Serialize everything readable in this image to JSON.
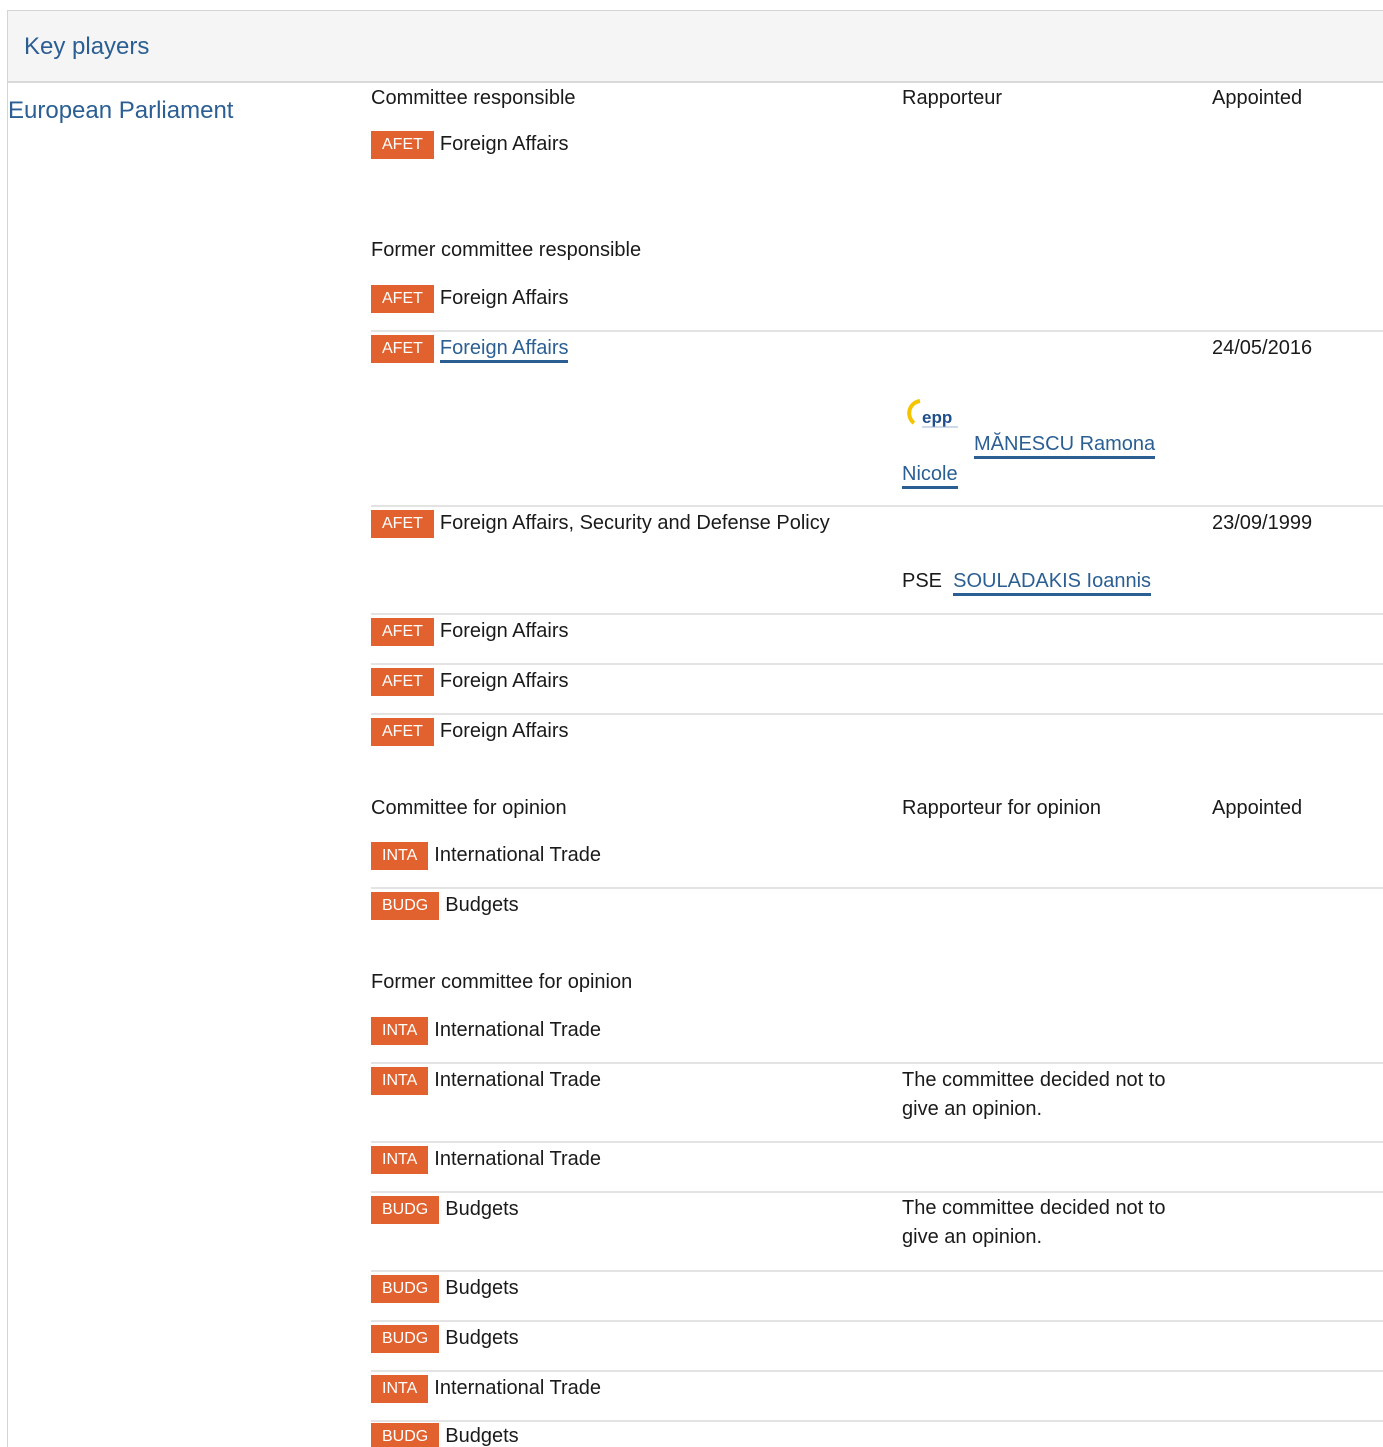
{
  "panel": {
    "title": "Key players"
  },
  "institution": {
    "label": "European Parliament"
  },
  "responsible": {
    "col_committee": "Committee responsible",
    "col_rapporteur": "Rapporteur",
    "col_appointed": "Appointed",
    "current": {
      "code": "AFET",
      "name": "Foreign Affairs"
    },
    "former_heading": "Former committee responsible",
    "former": [
      {
        "code": "AFET",
        "name": "Foreign Affairs"
      },
      {
        "code": "AFET",
        "name": "Foreign Affairs",
        "date": "24/05/2016",
        "rapporteur_group": "epp",
        "rapporteur_line1": "MĂNESCU Ramona",
        "rapporteur_line2": "Nicole"
      },
      {
        "code": "AFET",
        "name": "Foreign Affairs, Security and Defense Policy",
        "date": "23/09/1999",
        "rapporteur_group": "PSE",
        "rapporteur": "SOULADAKIS Ioannis"
      },
      {
        "code": "AFET",
        "name": "Foreign Affairs"
      },
      {
        "code": "AFET",
        "name": "Foreign Affairs"
      },
      {
        "code": "AFET",
        "name": "Foreign Affairs"
      }
    ]
  },
  "opinion": {
    "col_committee": "Committee for opinion",
    "col_rapporteur": "Rapporteur for opinion",
    "col_appointed": "Appointed",
    "current": [
      {
        "code": "INTA",
        "name": "International Trade"
      },
      {
        "code": "BUDG",
        "name": "Budgets"
      }
    ],
    "former_heading": "Former committee for opinion",
    "former": [
      {
        "code": "INTA",
        "name": "International Trade"
      },
      {
        "code": "INTA",
        "name": "International Trade",
        "note_line1": "The committee decided not to",
        "note_line2": "give an opinion."
      },
      {
        "code": "INTA",
        "name": "International Trade"
      },
      {
        "code": "BUDG",
        "name": "Budgets",
        "note_line1": "The committee decided not to",
        "note_line2": "give an opinion."
      },
      {
        "code": "BUDG",
        "name": "Budgets"
      },
      {
        "code": "BUDG",
        "name": "Budgets"
      },
      {
        "code": "INTA",
        "name": "International Trade"
      },
      {
        "code": "BUDG",
        "name": "Budgets"
      }
    ]
  },
  "colors": {
    "badge": "#e2622f",
    "link": "#2b5f93",
    "header_bg": "#f5f5f5"
  }
}
